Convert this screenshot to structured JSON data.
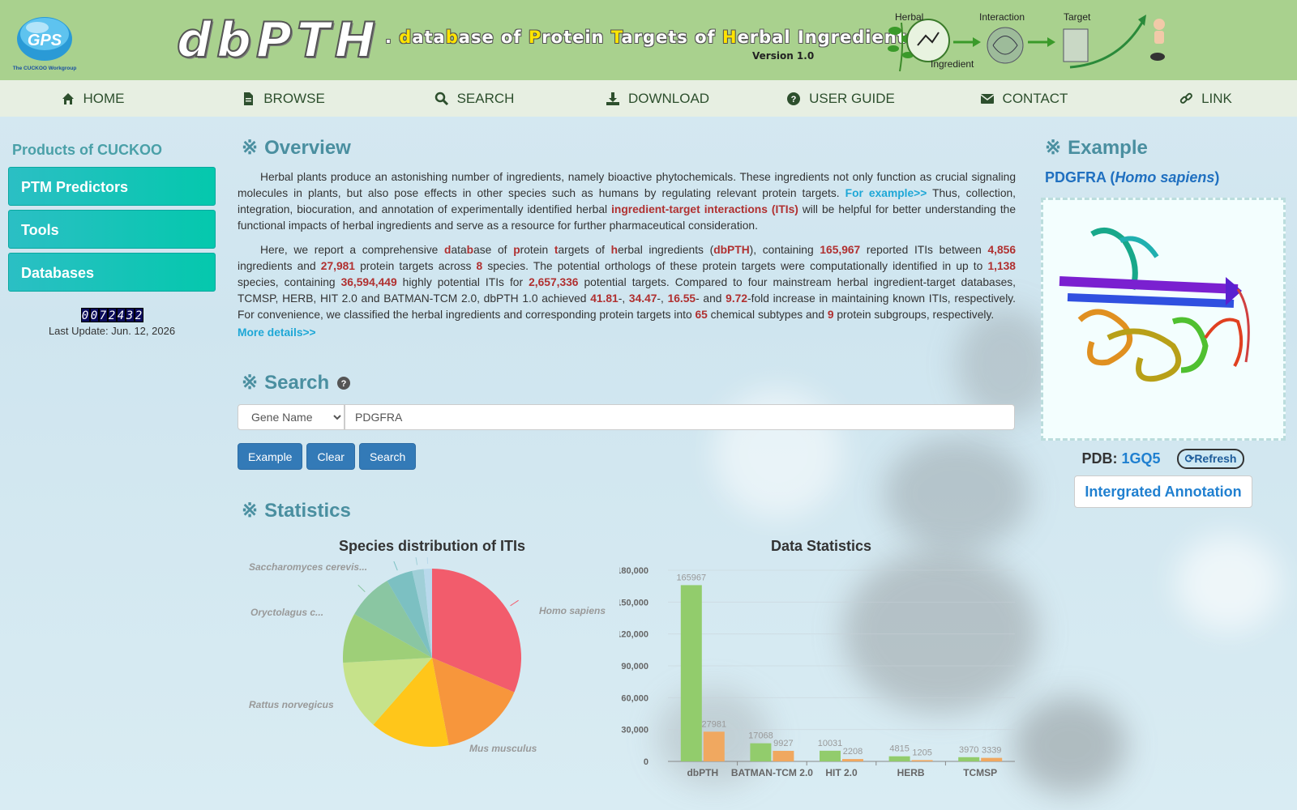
{
  "header": {
    "logo_text": "GPS",
    "logo_sub": "The CUCKOO Workgroup",
    "brand_big": "dbPTH",
    "brand_sub_parts": [
      {
        "t": ".",
        "hl": false
      },
      {
        "t": " d",
        "hl": true
      },
      {
        "t": "ata",
        "hl": false
      },
      {
        "t": "b",
        "hl": true
      },
      {
        "t": "ase of ",
        "hl": false
      },
      {
        "t": "P",
        "hl": true
      },
      {
        "t": "rotein ",
        "hl": false
      },
      {
        "t": "T",
        "hl": true
      },
      {
        "t": "argets of ",
        "hl": false
      },
      {
        "t": "H",
        "hl": true
      },
      {
        "t": "erbal Ingredients",
        "hl": false
      }
    ],
    "version": "Version 1.0",
    "pipeline": {
      "herbal": "Herbal",
      "ingredient": "Ingredient",
      "interaction": "Interaction",
      "target": "Target"
    }
  },
  "nav": [
    {
      "label": "HOME",
      "icon": "home-icon"
    },
    {
      "label": "BROWSE",
      "icon": "file-icon"
    },
    {
      "label": "SEARCH",
      "icon": "search-icon"
    },
    {
      "label": "DOWNLOAD",
      "icon": "download-icon"
    },
    {
      "label": "USER GUIDE",
      "icon": "question-icon"
    },
    {
      "label": "CONTACT",
      "icon": "envelope-icon"
    },
    {
      "label": "LINK",
      "icon": "link-icon"
    }
  ],
  "sidebar": {
    "title": "Products of CUCKOO",
    "items": [
      "PTM Predictors",
      "Tools",
      "Databases"
    ],
    "counter": "0072432",
    "last_update": "Last Update: Jun. 12, 2026"
  },
  "overview": {
    "title": "Overview",
    "p1_a": "Herbal plants produce an astonishing number of ingredients, namely bioactive phytochemicals. These ingredients not only function as crucial signaling molecules in plants, but also pose effects in other species such as humans by regulating relevant protein targets. ",
    "p1_link": "For example>>",
    "p1_b": " Thus, collection, integration, biocuration, and annotation of experimentally identified herbal ",
    "p1_red": "ingredient-target interactions (ITIs)",
    "p1_c": " will be helpful for better understanding the functional impacts of herbal ingredients and serve as a resource for further pharmaceutical consideration.",
    "p2": [
      {
        "t": "Here, we report a comprehensive ",
        "r": false
      },
      {
        "t": "d",
        "r": true
      },
      {
        "t": "ata",
        "r": false
      },
      {
        "t": "b",
        "r": true
      },
      {
        "t": "ase of ",
        "r": false
      },
      {
        "t": "p",
        "r": true
      },
      {
        "t": "rotein ",
        "r": false
      },
      {
        "t": "t",
        "r": true
      },
      {
        "t": "argets of ",
        "r": false
      },
      {
        "t": "h",
        "r": true
      },
      {
        "t": "erbal ingredients (",
        "r": false
      },
      {
        "t": "dbPTH",
        "r": true
      },
      {
        "t": "), containing ",
        "r": false
      },
      {
        "t": "165,967",
        "r": true
      },
      {
        "t": " reported ITIs between ",
        "r": false
      },
      {
        "t": "4,856",
        "r": true
      },
      {
        "t": " ingredients and ",
        "r": false
      },
      {
        "t": "27,981",
        "r": true
      },
      {
        "t": " protein targets across ",
        "r": false
      },
      {
        "t": "8",
        "r": true
      },
      {
        "t": " species. The potential orthologs of these protein targets were computationally identified in up to ",
        "r": false
      },
      {
        "t": "1,138",
        "r": true
      },
      {
        "t": " species, containing ",
        "r": false
      },
      {
        "t": "36,594,449",
        "r": true
      },
      {
        "t": " highly potential ITIs for ",
        "r": false
      },
      {
        "t": "2,657,336",
        "r": true
      },
      {
        "t": " potential targets. Compared to four mainstream herbal ingredient-target databases, TCMSP, HERB, HIT 2.0 and BATMAN-TCM 2.0, dbPTH 1.0 achieved ",
        "r": false
      },
      {
        "t": "41.81",
        "r": true
      },
      {
        "t": "-, ",
        "r": false
      },
      {
        "t": "34.47",
        "r": true
      },
      {
        "t": "-, ",
        "r": false
      },
      {
        "t": "16.55",
        "r": true
      },
      {
        "t": "- and ",
        "r": false
      },
      {
        "t": "9.72",
        "r": true
      },
      {
        "t": "-fold increase in maintaining known ITIs, respectively. For convenience, we classified the herbal ingredients and corresponding protein targets into ",
        "r": false
      },
      {
        "t": "65",
        "r": true
      },
      {
        "t": " chemical subtypes and ",
        "r": false
      },
      {
        "t": "9",
        "r": true
      },
      {
        "t": " protein subgroups, respectively.",
        "r": false
      }
    ],
    "more": "More details>>"
  },
  "search": {
    "title": "Search",
    "select_value": "Gene Name",
    "input_value": "PDGFRA",
    "buttons": [
      "Example",
      "Clear",
      "Search"
    ]
  },
  "statistics": {
    "title": "Statistics"
  },
  "example": {
    "title": "Example",
    "gene": "PDGFRA",
    "species": "Homo sapiens",
    "pdb_label": "PDB:",
    "pdb_id": "1GQ5",
    "refresh": "Refresh",
    "annotation": "Intergrated Annotation"
  },
  "chart_data": [
    {
      "type": "pie",
      "title": "Species distribution of ITIs",
      "labels": [
        "Homo sapiens",
        "",
        "",
        "",
        "",
        "Mus musculus",
        "Rattus norvegicus",
        "Oryctolagus c...",
        "Saccharomyces cerevis..."
      ],
      "values": [
        52000,
        26000,
        24000,
        21000,
        15000,
        14000,
        8000,
        3500,
        2467
      ],
      "colors": [
        "#f25c6c",
        "#f7963c",
        "#ffc61a",
        "#c6e28a",
        "#9ecf78",
        "#8ac6a2",
        "#7cc0c2",
        "#a0cfd8",
        "#b9d9ec"
      ]
    },
    {
      "type": "bar",
      "title": "Data Statistics",
      "categories": [
        "dbPTH",
        "BATMAN-TCM 2.0",
        "HIT 2.0",
        "HERB",
        "TCMSP"
      ],
      "series": [
        {
          "values": [
            165967,
            17068,
            10031,
            4815,
            3970
          ],
          "color": "#92cc6c"
        },
        {
          "values": [
            27981,
            9927,
            2208,
            1205,
            3339
          ],
          "color": "#f0a860"
        }
      ],
      "yticks": [
        0,
        30000,
        60000,
        90000,
        120000,
        150000,
        180000
      ],
      "ylim": [
        0,
        180000
      ]
    }
  ]
}
